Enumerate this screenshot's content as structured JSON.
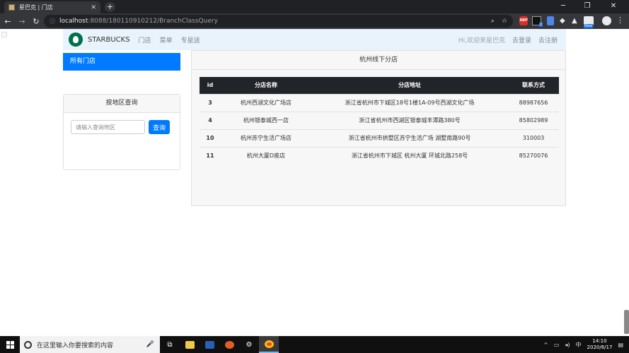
{
  "browser": {
    "tab_title": "星巴克 | 门店",
    "tab_close": "✕",
    "new_tab": "+",
    "url_host": "localhost",
    "url_rest": ":8088/180110910212/BranchClassQuery",
    "window_min": "─",
    "window_max": "❐",
    "window_close": "✕",
    "ext_abp": "ABP",
    "ext_badge_2": "2",
    "ext_badge_new": "New"
  },
  "navbar": {
    "brand": "STARBUCKS",
    "links": [
      "门店",
      "菜单",
      "专星送"
    ],
    "greeting": "Hi,欢迎来星巴克",
    "login": "去登录",
    "register": "去注册"
  },
  "sidebar": {
    "active_item": "所有门店",
    "search_title": "按地区查询",
    "search_placeholder": "请输入查询地区",
    "search_button": "查询"
  },
  "main": {
    "title": "杭州线下分店",
    "columns": [
      "id",
      "分店名称",
      "分店地址",
      "联系方式"
    ],
    "rows": [
      {
        "id": "3",
        "name": "杭州西湖文化广场店",
        "address": "浙江省杭州市下城区18号1楼1A-09号西湖文化广场",
        "phone": "88987656"
      },
      {
        "id": "4",
        "name": "杭州银泰城西一店",
        "address": "浙江省杭州市西湖区银泰城丰潭路380号",
        "phone": "85802989"
      },
      {
        "id": "10",
        "name": "杭州苏宁生活广场店",
        "address": "浙江省杭州市拱墅区苏宁生活广场 湖墅南路90号",
        "phone": "310003"
      },
      {
        "id": "11",
        "name": "杭州大厦D座店",
        "address": "浙江省杭州市下城区 杭州大厦 环城北路258号",
        "phone": "85270076"
      }
    ]
  },
  "taskbar": {
    "search_text": "在这里输入你要搜索的内容",
    "time": "14:10",
    "date": "2020/6/17"
  }
}
